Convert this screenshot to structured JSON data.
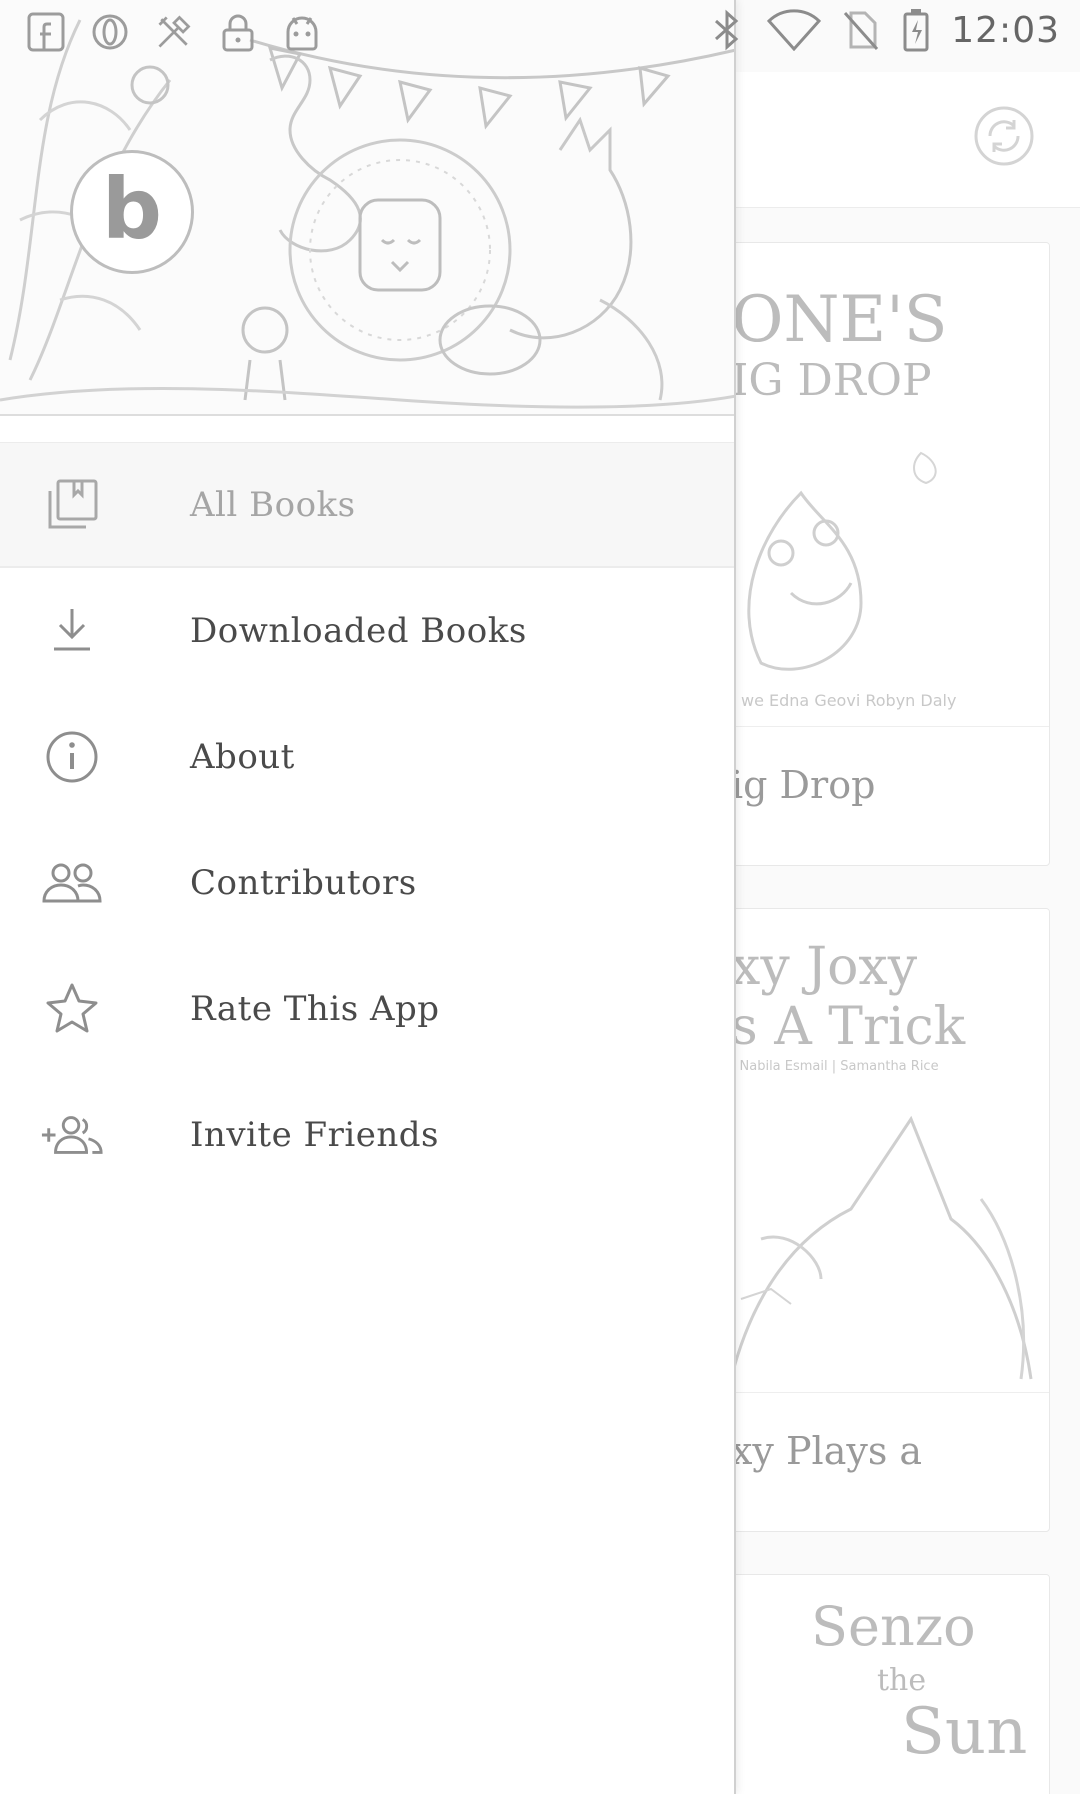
{
  "status_bar": {
    "time": "12:03",
    "left_icons": [
      "facebook-icon",
      "opera-icon",
      "tools-icon",
      "lock-icon",
      "android-icon"
    ],
    "right_icons": [
      "bluetooth-icon",
      "wifi-icon",
      "no-sim-icon",
      "battery-charging-icon"
    ]
  },
  "drawer": {
    "logo_letter": "b",
    "menu": [
      {
        "label": "All Books",
        "icon": "library-icon",
        "active": true
      },
      {
        "label": "Downloaded Books",
        "icon": "download-icon",
        "active": false
      },
      {
        "label": "About",
        "icon": "info-icon",
        "active": false
      },
      {
        "label": "Contributors",
        "icon": "people-icon",
        "active": false
      },
      {
        "label": "Rate This App",
        "icon": "star-icon",
        "active": false
      },
      {
        "label": "Invite Friends",
        "icon": "add-people-icon",
        "active": false
      }
    ]
  },
  "background": {
    "books": [
      {
        "cover_line1": "ONE'S",
        "cover_line2": "IG DROP",
        "cover_credits": "we   Edna Geovi   Robyn Daly",
        "title": "ig Drop"
      },
      {
        "cover_line1": "xy Joxy",
        "cover_line2": "s A Trick",
        "cover_credits": "|  Nabila Esmail  |  Samantha Rice",
        "title": "xy Plays a"
      },
      {
        "cover_line1": "Senzo",
        "cover_line2": "the",
        "cover_line3": "Sun"
      }
    ]
  }
}
